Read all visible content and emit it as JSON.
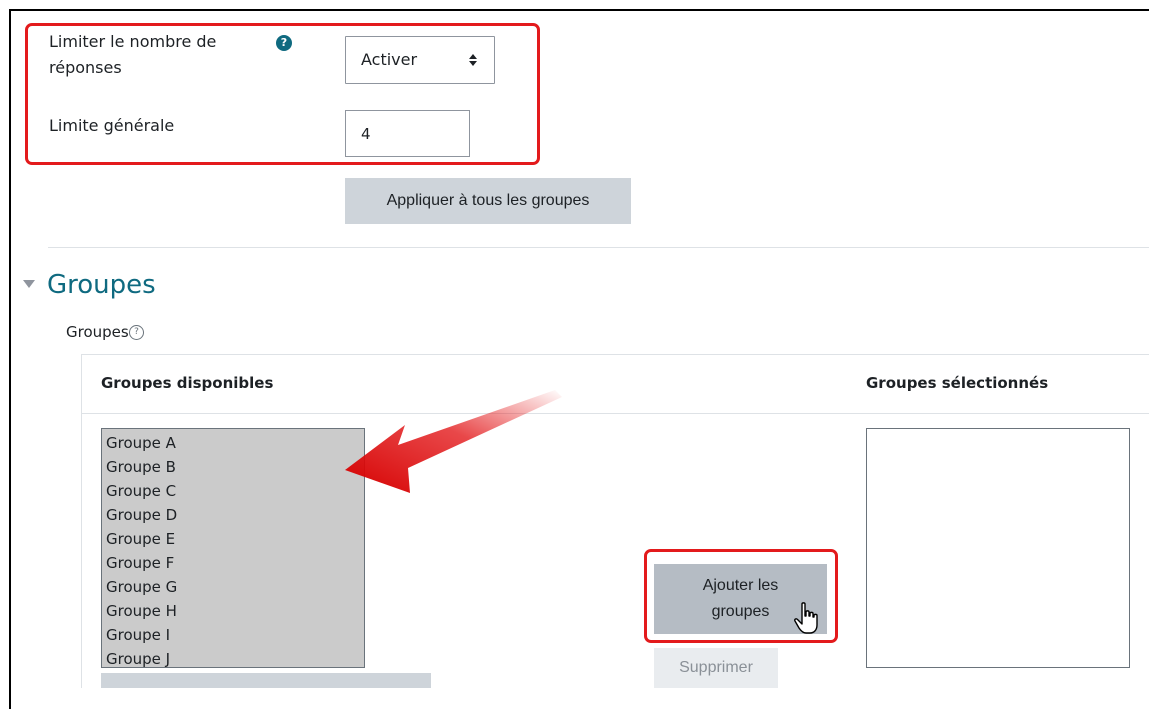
{
  "response_limit": {
    "label": "Limiter le nombre de réponses",
    "select_value": "Activer",
    "general_limit_label": "Limite générale",
    "general_limit_value": "4",
    "apply_button": "Appliquer à tous les groupes"
  },
  "groups_section": {
    "title": "Groupes",
    "field_label": "Groupes",
    "available_header": "Groupes disponibles",
    "selected_header": "Groupes sélectionnés",
    "available": [
      "Groupe A",
      "Groupe B",
      "Groupe C",
      "Groupe D",
      "Groupe E",
      "Groupe F",
      "Groupe G",
      "Groupe H",
      "Groupe I",
      "Groupe J"
    ],
    "add_button": "Ajouter les groupes",
    "remove_button": "Supprimer"
  },
  "colors": {
    "accent": "#0f6a80",
    "highlight_red": "#e31a1c",
    "button_gray": "#ced4da"
  }
}
